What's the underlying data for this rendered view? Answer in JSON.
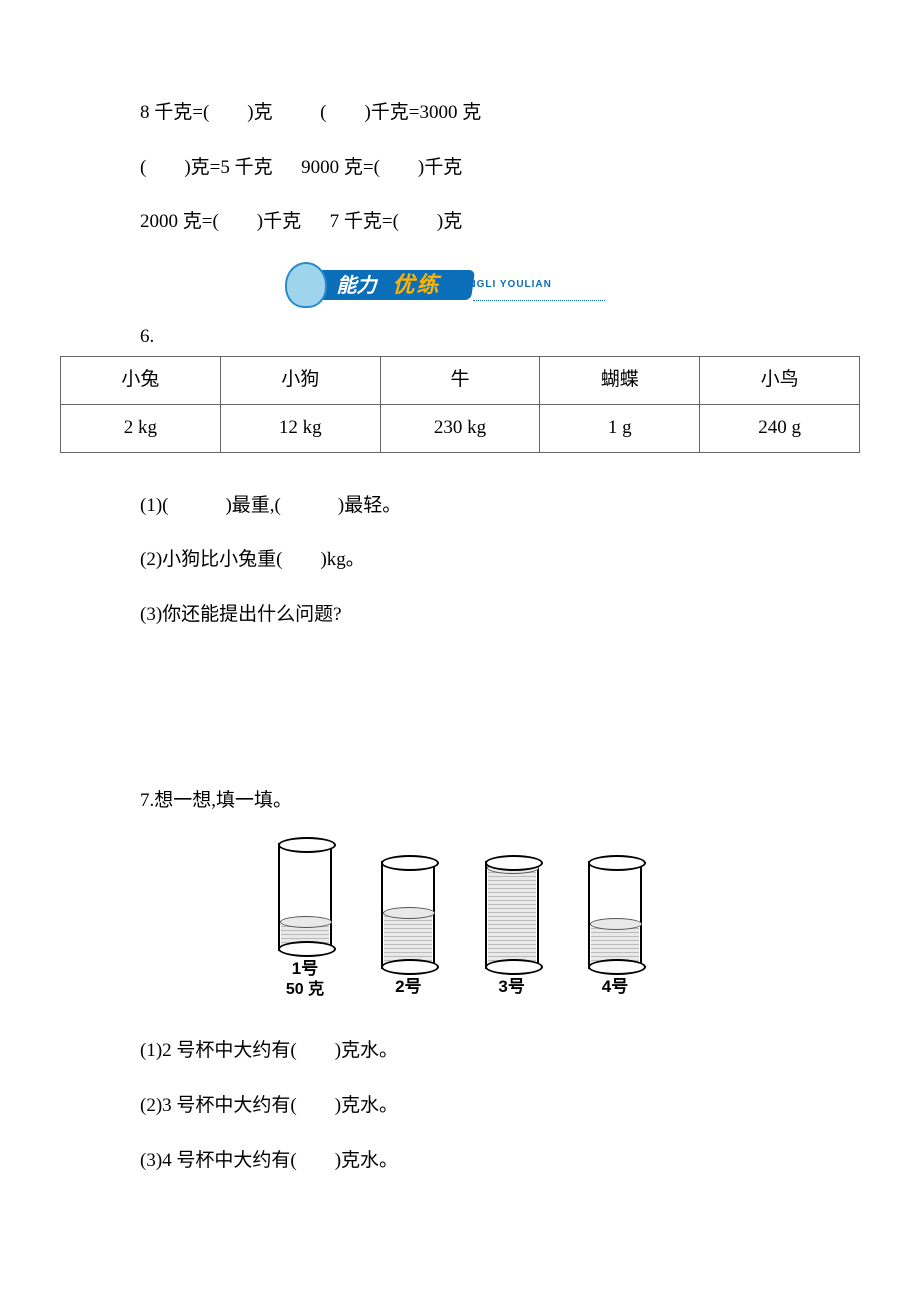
{
  "conversions": {
    "line1_a": "8 千克=(　　)克",
    "line1_b": "(　　)千克=3000 克",
    "line2_a": "(　　)克=5 千克",
    "line2_b": "9000 克=(　　)千克",
    "line3_a": "2000 克=(　　)千克",
    "line3_b": "7 千克=(　　)克"
  },
  "banner": {
    "part1": "能力",
    "part2": "优练",
    "pinyin": "NENGLI YOULIAN"
  },
  "q6": {
    "num": "6.",
    "headers": [
      "小兔",
      "小狗",
      "牛",
      "蝴蝶",
      "小鸟"
    ],
    "values": [
      "2 kg",
      "12 kg",
      "230 kg",
      "1 g",
      "240 g"
    ],
    "sub1": "(1)(　　　)最重,(　　　)最轻。",
    "sub2": "(2)小狗比小兔重(　　)kg。",
    "sub3": "(3)你还能提出什么问题?"
  },
  "q7": {
    "title": "7.想一想,填一填。",
    "cups": [
      {
        "label": "1号",
        "sub": "50 克"
      },
      {
        "label": "2号",
        "sub": ""
      },
      {
        "label": "3号",
        "sub": ""
      },
      {
        "label": "4号",
        "sub": ""
      }
    ],
    "sub1": "(1)2 号杯中大约有(　　)克水。",
    "sub2": "(2)3 号杯中大约有(　　)克水。",
    "sub3": "(3)4 号杯中大约有(　　)克水。"
  },
  "chart_data": {
    "type": "table",
    "title": "",
    "categories": [
      "小兔",
      "小狗",
      "牛",
      "蝴蝶",
      "小鸟"
    ],
    "values_display": [
      "2 kg",
      "12 kg",
      "230 kg",
      "1 g",
      "240 g"
    ],
    "series": [
      {
        "name": "mass_grams",
        "values": [
          2000,
          12000,
          230000,
          1,
          240
        ]
      }
    ],
    "cups_g": {
      "1号": 50,
      "2号": null,
      "3号": null,
      "4号": null
    }
  }
}
